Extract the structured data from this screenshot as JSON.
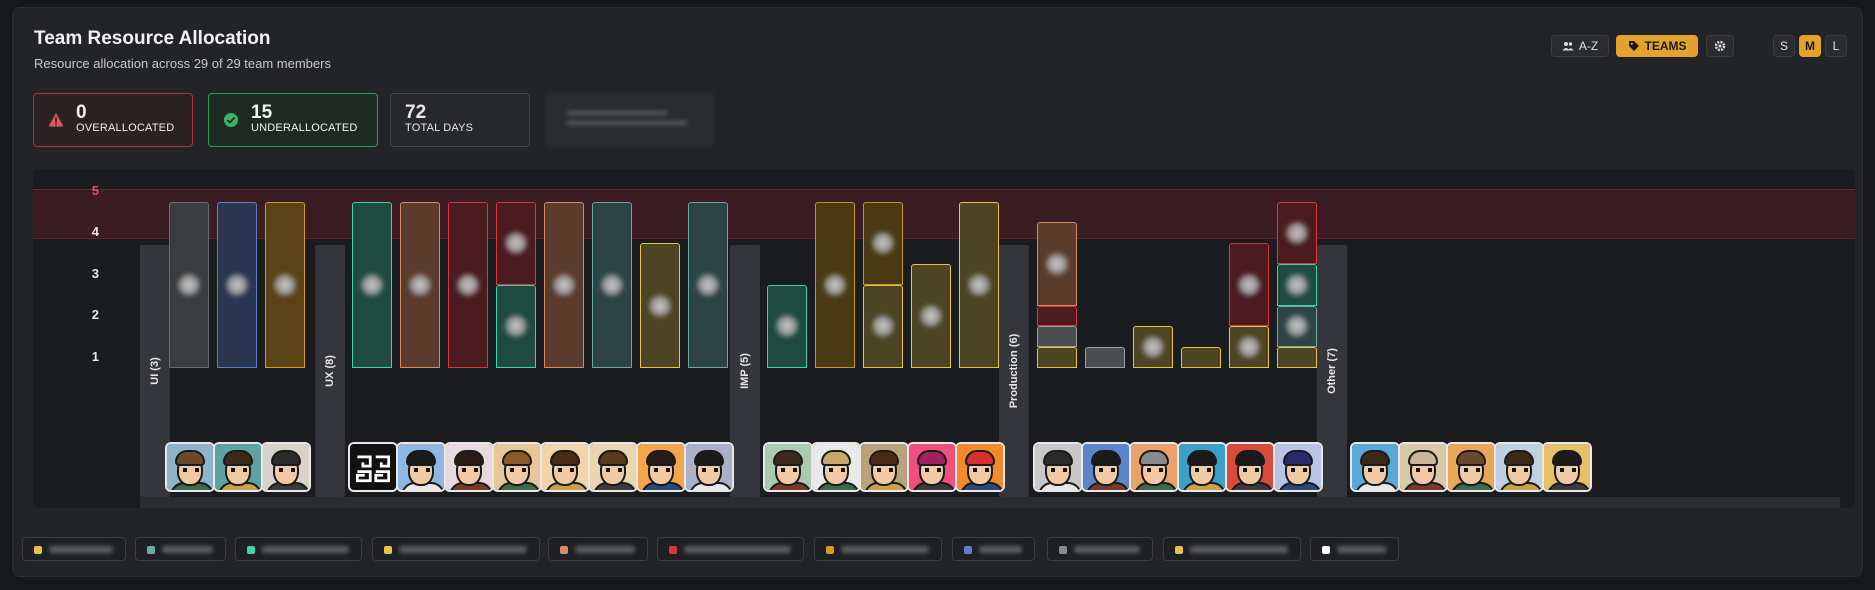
{
  "header": {
    "title": "Team Resource Allocation",
    "subtitle": "Resource allocation across 29 of 29 team members"
  },
  "stats": {
    "overallocated": {
      "value": "0",
      "label": "OVERALLOCATED"
    },
    "underallocated": {
      "value": "15",
      "label": "UNDERALLOCATED"
    },
    "total_days": {
      "value": "72",
      "label": "TOTAL DAYS"
    }
  },
  "toolbar": {
    "sort_label": "A-Z",
    "teams_label": "TEAMS",
    "size_options": [
      "S",
      "M",
      "L"
    ],
    "size_selected": "M"
  },
  "chart": {
    "y_ticks": [
      "5",
      "4",
      "3",
      "2",
      "1"
    ],
    "groups": [
      "UI (3)",
      "UX (8)",
      "IMP (5)",
      "Production (6)",
      "Other (7)"
    ]
  },
  "colors": {
    "accent": "#e2a22b",
    "danger": "#d9363e",
    "success": "#2f9b5a"
  }
}
